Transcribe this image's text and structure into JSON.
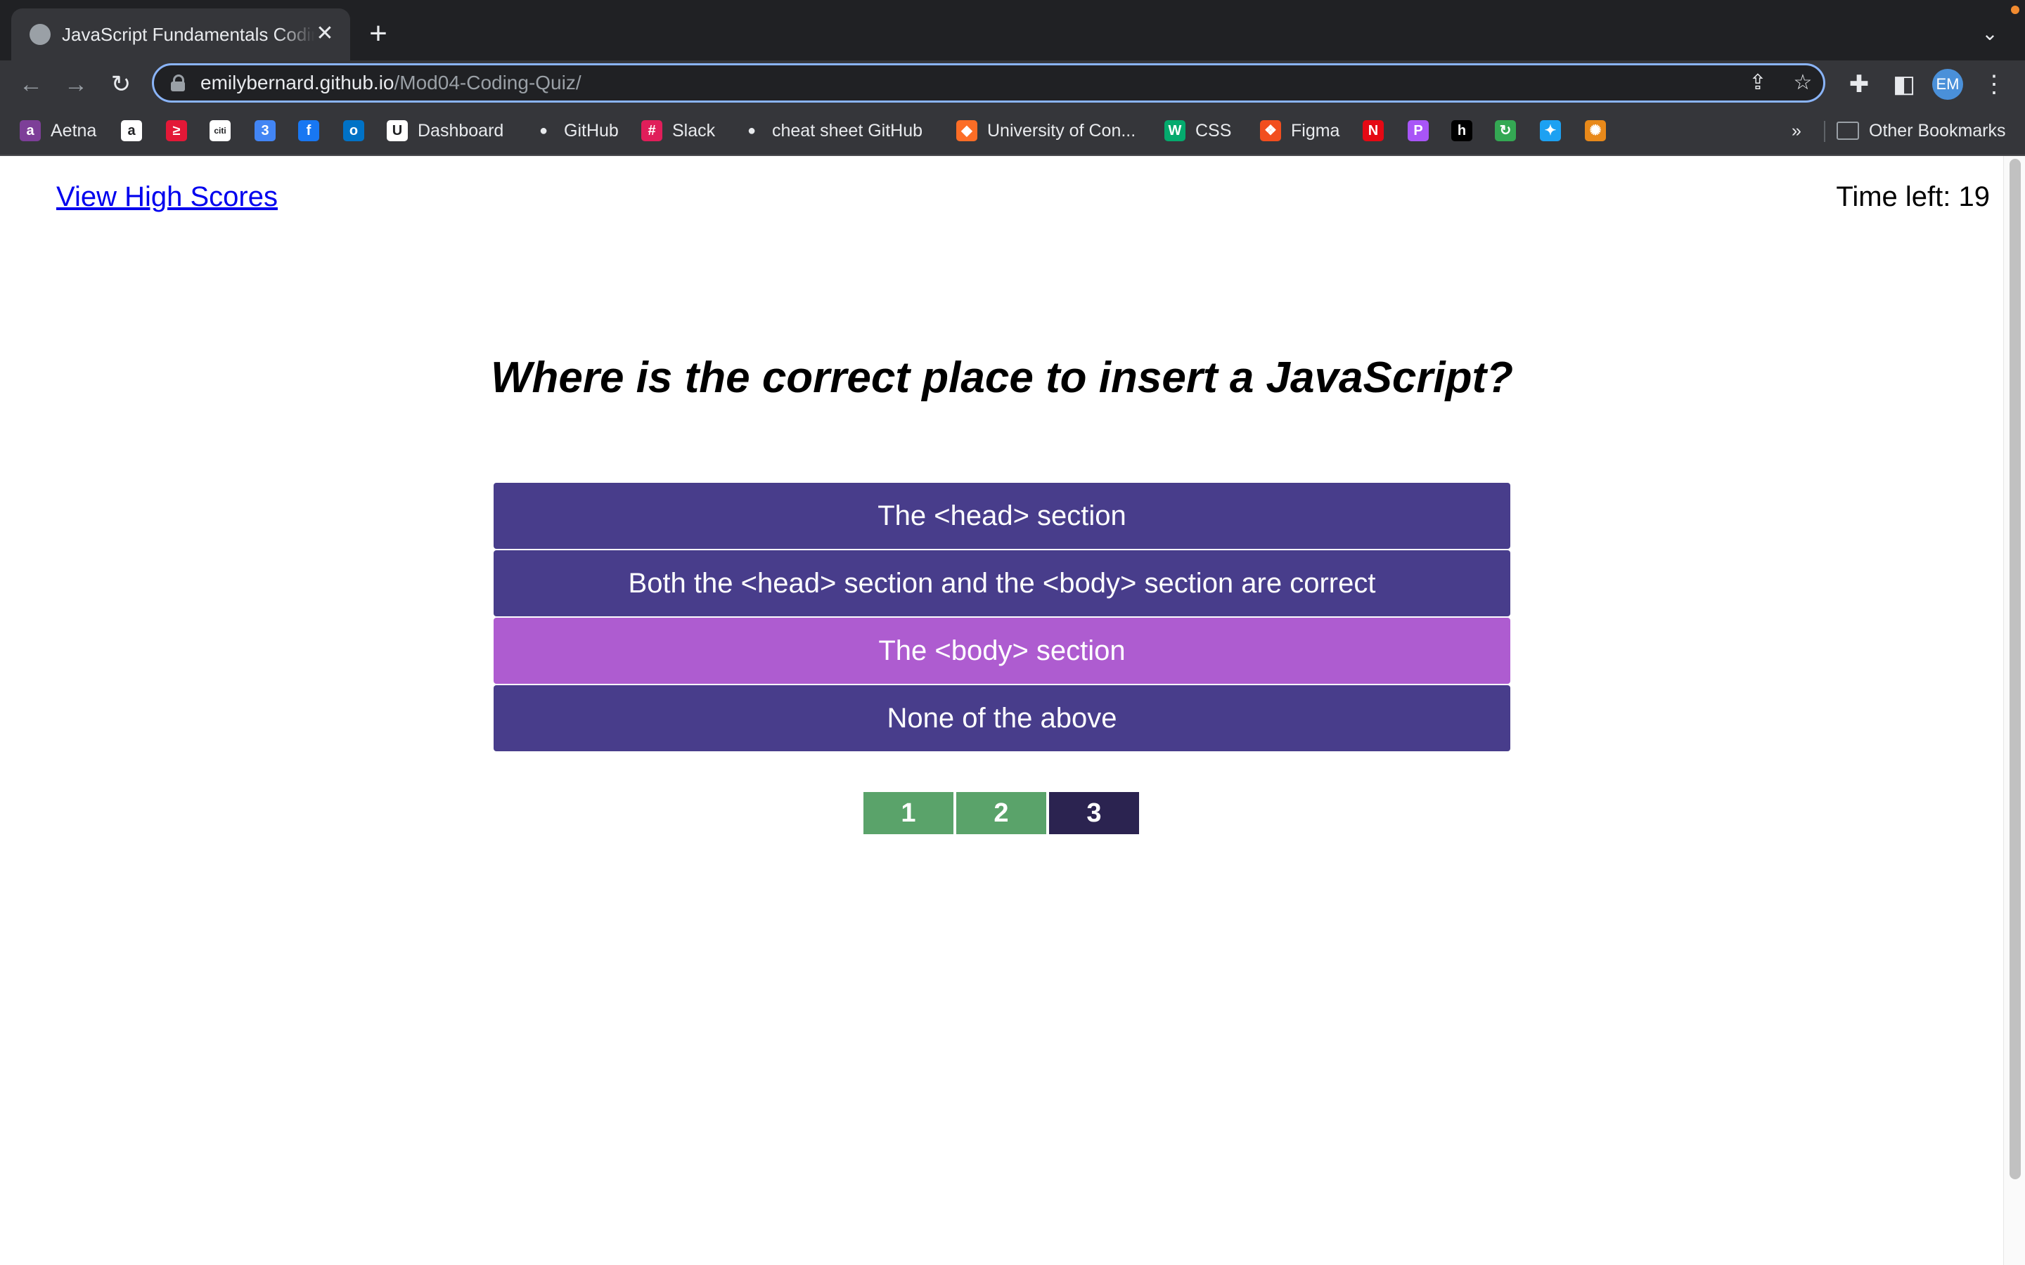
{
  "browser": {
    "tab_title": "JavaScript Fundamentals Coding Quiz",
    "tab_close": "✕",
    "new_tab": "+",
    "url_host": "emilybernard.github.io",
    "url_path": "/Mod04-Coding-Quiz/",
    "profile_initials": "EM",
    "bookmarks_overflow": "»",
    "bookmarks": [
      {
        "label": "Aetna",
        "icon": "aetna-icon",
        "color": "#7d3f98",
        "glyph": "a"
      },
      {
        "label": "",
        "icon": "amazon-icon",
        "color": "#ffffff",
        "glyph": "a"
      },
      {
        "label": "",
        "icon": "bank-of-america-icon",
        "color": "#e31837",
        "glyph": "≥"
      },
      {
        "label": "",
        "icon": "citi-icon",
        "color": "#ffffff",
        "glyph": "citi"
      },
      {
        "label": "",
        "icon": "google-calendar-icon",
        "color": "#4285f4",
        "glyph": "3"
      },
      {
        "label": "",
        "icon": "facebook-icon",
        "color": "#1877f2",
        "glyph": "f"
      },
      {
        "label": "",
        "icon": "outlook-icon",
        "color": "#0072c6",
        "glyph": "o"
      },
      {
        "label": "Dashboard",
        "icon": "dashboard-icon",
        "color": "#ffffff",
        "glyph": "U"
      },
      {
        "label": "GitHub",
        "icon": "github-icon",
        "color": "#e8eaed",
        "glyph": "●"
      },
      {
        "label": "Slack",
        "icon": "slack-icon",
        "color": "#e01e5a",
        "glyph": "#"
      },
      {
        "label": "cheat sheet GitHub",
        "icon": "github-icon",
        "color": "#e8eaed",
        "glyph": "●"
      },
      {
        "label": "University of Con...",
        "icon": "gitlab-icon",
        "color": "#fc6d26",
        "glyph": "◆"
      },
      {
        "label": "CSS",
        "icon": "w3schools-icon",
        "color": "#04aa6d",
        "glyph": "W"
      },
      {
        "label": "Figma",
        "icon": "figma-icon",
        "color": "#f24e1e",
        "glyph": "❖"
      },
      {
        "label": "",
        "icon": "netflix-icon",
        "color": "#e50914",
        "glyph": "N"
      },
      {
        "label": "",
        "icon": "pocketcasts-icon",
        "color": "#a855f7",
        "glyph": "P"
      },
      {
        "label": "",
        "icon": "hackerrank-icon",
        "color": "#000000",
        "glyph": "h"
      },
      {
        "label": "",
        "icon": "refresh-app-icon",
        "color": "#34a853",
        "glyph": "↻"
      },
      {
        "label": "",
        "icon": "bird-icon",
        "color": "#1da1f2",
        "glyph": "✦"
      },
      {
        "label": "",
        "icon": "sunflower-icon",
        "color": "#e8891a",
        "glyph": "✺"
      }
    ],
    "other_bookmarks": "Other Bookmarks"
  },
  "page": {
    "high_scores_link": "View High Scores",
    "timer_label": "Time left:",
    "timer_value": "19",
    "question": "Where is the correct place to insert a JavaScript?",
    "answers": [
      {
        "text": "The <head> section",
        "color": "#483d8b"
      },
      {
        "text": "Both the <head> section and the <body> section are correct",
        "color": "#483d8b"
      },
      {
        "text": "The <body> section",
        "color": "#ae5cd0"
      },
      {
        "text": "None of the above",
        "color": "#483d8b"
      }
    ],
    "progress": [
      {
        "label": "1",
        "color": "#5aa36a",
        "status": "correct"
      },
      {
        "label": "2",
        "color": "#5aa36a",
        "status": "correct"
      },
      {
        "label": "3",
        "color": "#2b2350",
        "status": "current"
      }
    ]
  }
}
